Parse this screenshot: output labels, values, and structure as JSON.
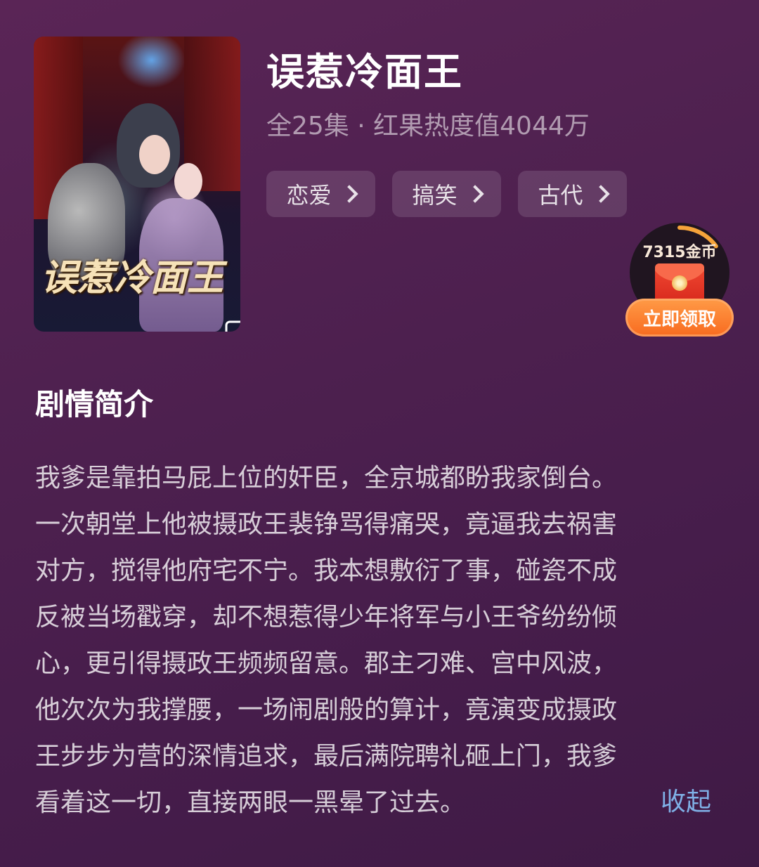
{
  "drama": {
    "poster_title": "误惹冷面王",
    "title": "误惹冷面王",
    "subtitle": "全25集 · 红果热度值4044万",
    "tags": [
      {
        "label": "恋爱"
      },
      {
        "label": "搞笑"
      },
      {
        "label": "古代"
      }
    ]
  },
  "reward": {
    "coins_label": "7315金币",
    "claim_label": "立即领取",
    "progress": 0.15,
    "accent_color": "#f86a1f"
  },
  "synopsis": {
    "heading": "剧情简介",
    "lines": [
      "我爹是靠拍马屁上位的奸臣，全京城都盼我家倒台。",
      "一次朝堂上他被摄政王裴铮骂得痛哭，竟逼我去祸害",
      "对方，搅得他府宅不宁。我本想敷衍了事，碰瓷不成",
      "反被当场戳穿，却不想惹得少年将军与小王爷纷纷倾",
      "心，更引得摄政王频频留意。郡主刁难、宫中风波，",
      "他次次为我撑腰，一场闹剧般的算计，竟演变成摄政",
      "王步步为营的深情追求，最后满院聘礼砸上门，我爹",
      "看着这一切，直接两眼一黑晕了过去。"
    ],
    "collapse_label": "收起"
  },
  "icons": {
    "poster_badge": "share-card-icon",
    "tag_arrow": "chevron-right-icon",
    "reward_envelope": "red-envelope-icon"
  }
}
